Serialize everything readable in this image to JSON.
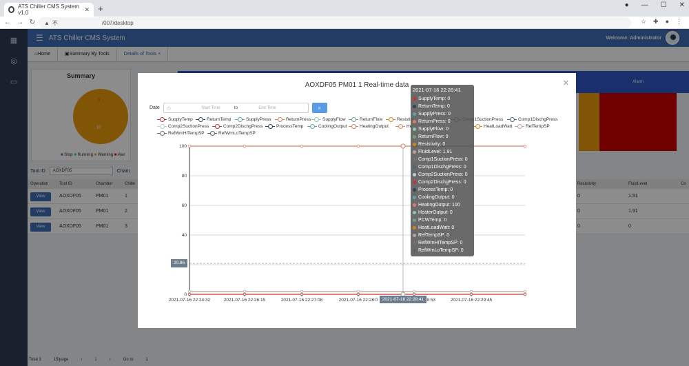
{
  "browser": {
    "tab_title": "ATS Chiller CMS System v1.0",
    "url_prefix": "不",
    "url": "/007/desktop"
  },
  "app": {
    "title": "ATS Chiller CMS System",
    "welcome": "Welcome: Administrator",
    "tabs": [
      {
        "label": "Home",
        "icon": "home-icon"
      },
      {
        "label": "Summary By Tools",
        "icon": "list-icon"
      },
      {
        "label": "Details of Tools",
        "icon": "",
        "closable": true
      }
    ]
  },
  "background": {
    "summary_title": "Summary",
    "pie_labels": [
      "0",
      "37"
    ],
    "legend": [
      "Stop",
      "Running",
      "Warning",
      "Alar"
    ],
    "alarm_header": "Alarm",
    "tool_id_label": "Tool ID",
    "tool_id_value": "AOXDF05",
    "chamber_label": "Cham",
    "columns": [
      "Operation",
      "Tool ID",
      "Chamber",
      "Chille",
      "Resistivity",
      "FluidLevel",
      "Co"
    ],
    "rows": [
      {
        "view": "View",
        "tool": "AOXDF05",
        "chamber": "PM01",
        "chiller": "1",
        "res": "0",
        "fluid": "1.91"
      },
      {
        "view": "View",
        "tool": "AOXDF05",
        "chamber": "PM01",
        "chiller": "2",
        "res": "0",
        "fluid": "1.91"
      },
      {
        "view": "View",
        "tool": "AOXDF05",
        "chamber": "PM01",
        "chiller": "3",
        "res": "0",
        "fluid": "0"
      }
    ],
    "footer": {
      "total": "Total 3",
      "per_page": "15/page",
      "page": "1",
      "goto": "Go to",
      "goto_value": "1"
    }
  },
  "modal": {
    "title": "AOXDF05 PM01 1 Real-time data",
    "date_label": "Date",
    "start_placeholder": "Start Time",
    "to": "to",
    "end_placeholder": "End Time",
    "crosshair_y": "20.86",
    "crosshair_x": "2021-07-16 22:28:41"
  },
  "colors": {
    "SupplyTemp": "#c23531",
    "ReturnTemp": "#2f4554",
    "SupplyPress": "#61a0a8",
    "ReturnPress": "#d48265",
    "SupplyFlow": "#91c7ae",
    "ReturnFlow": "#749f83",
    "Resistivity": "#ca8622",
    "FluidLevel": "#bda29a",
    "Comp1SuctionPress": "#6e7074",
    "Comp1DischgPress": "#546570",
    "Comp2SuctionPress": "#c4ccd3",
    "Comp2DischgPress": "#c23531",
    "ProcessTemp": "#2f4554",
    "CoolingOutput": "#61a0a8",
    "HeatingOutput": "#d48265",
    "HeaterOutput": "#91c7ae",
    "PCWTemp": "#749f83",
    "HeatLoadWatt": "#ca8622",
    "RefTempSP": "#bda29a",
    "RefWrnHiTempSP": "#6e7074",
    "RefWrnLoTempSP": "#546570"
  },
  "chart_data": {
    "type": "line",
    "x": [
      "2021-07-16 22:24:32",
      "2021-07-16 22:26:15",
      "2021-07-16 22:27:08",
      "2021-07-16 22:28:0",
      "2021-07-16 22:28:53",
      "2021-07-16 22:29:45"
    ],
    "ylim": [
      0,
      100
    ],
    "yticks": [
      0,
      20,
      40,
      60,
      80,
      100
    ],
    "series": [
      {
        "name": "SupplyTemp"
      },
      {
        "name": "ReturnTemp"
      },
      {
        "name": "SupplyPress"
      },
      {
        "name": "ReturnPress"
      },
      {
        "name": "SupplyFlow"
      },
      {
        "name": "ReturnFlow"
      },
      {
        "name": "Resistivi"
      },
      {
        "name": "Comp1SuctionPress"
      },
      {
        "name": "Comp1DischgPress"
      },
      {
        "name": "Comp2SuctionPress"
      },
      {
        "name": "Comp2DischgPress"
      },
      {
        "name": "ProcessTemp"
      },
      {
        "name": "CoolingOutput"
      },
      {
        "name": "HeatingOutput"
      },
      {
        "name": "He"
      },
      {
        "name": "HeatLoadWatt"
      },
      {
        "name": "RefTempSP"
      },
      {
        "name": "RefWrnHiTempSP"
      },
      {
        "name": "RefWrnLoTempSP"
      }
    ],
    "lines": [
      {
        "name": "HeatingOutput",
        "value": 100
      },
      {
        "name": "FluidLevel",
        "value": 1.91
      },
      {
        "name": "others",
        "value": 0
      }
    ],
    "tooltip": {
      "time": "2021-07-16 22:28:41",
      "items": [
        {
          "name": "SupplyTemp",
          "value": "0"
        },
        {
          "name": "ReturnTemp",
          "value": "0"
        },
        {
          "name": "SupplyPress",
          "value": "0"
        },
        {
          "name": "ReturnPress",
          "value": "0"
        },
        {
          "name": "SupplyFlow",
          "value": "0"
        },
        {
          "name": "ReturnFlow",
          "value": "0"
        },
        {
          "name": "Resistivity",
          "value": "0"
        },
        {
          "name": "FluidLevel",
          "value": "1.91"
        },
        {
          "name": "Comp1SuctionPress",
          "value": "0"
        },
        {
          "name": "Comp1DischgPress",
          "value": "0"
        },
        {
          "name": "Comp2SuctionPress",
          "value": "0"
        },
        {
          "name": "Comp2DischgPress",
          "value": "0"
        },
        {
          "name": "ProcessTemp",
          "value": "0"
        },
        {
          "name": "CoolingOutput",
          "value": "0"
        },
        {
          "name": "HeatingOutput",
          "value": "100"
        },
        {
          "name": "HeaterOutput",
          "value": "0"
        },
        {
          "name": "PCWTemp",
          "value": "0"
        },
        {
          "name": "HeatLoadWatt",
          "value": "0"
        },
        {
          "name": "RefTempSP",
          "value": "0"
        },
        {
          "name": "RefWrnHiTempSP",
          "value": "0"
        },
        {
          "name": "RefWrnLoTempSP",
          "value": "0"
        }
      ]
    }
  }
}
